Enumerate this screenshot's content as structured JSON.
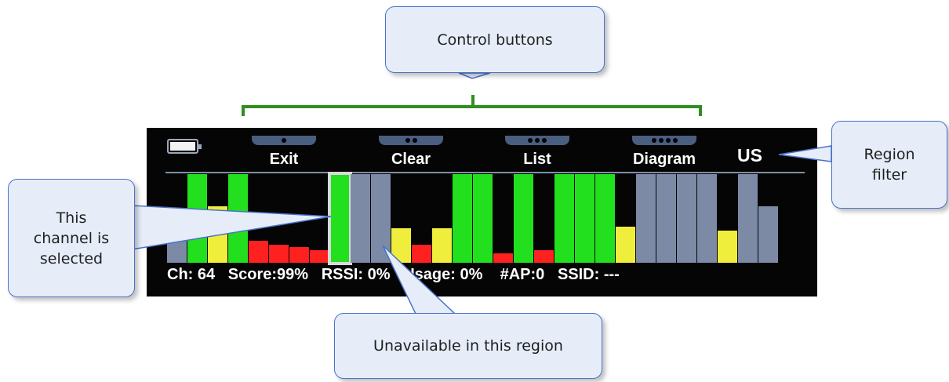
{
  "device": {
    "buttons": [
      {
        "label": "Exit",
        "dots": 1
      },
      {
        "label": "Clear",
        "dots": 2
      },
      {
        "label": "List",
        "dots": 3
      },
      {
        "label": "Diagram",
        "dots": 4
      }
    ],
    "region": "US",
    "status_line": "Ch: 64   Score:99%   RSSI: 0%   Usage: 0%    #AP:0   SSID: ---",
    "channel_bars": [
      {
        "level": 0.25,
        "color": "#7d8aa6"
      },
      {
        "level": 1.0,
        "color": "#22e01e"
      },
      {
        "level": 0.64,
        "color": "#f0ee3c"
      },
      {
        "level": 1.0,
        "color": "#22e01e"
      },
      {
        "level": 0.25,
        "color": "#ff2020"
      },
      {
        "level": 0.2,
        "color": "#ff2020"
      },
      {
        "level": 0.18,
        "color": "#ff2020"
      },
      {
        "level": 0.14,
        "color": "#ff2020"
      },
      {
        "level": 1.0,
        "color": "#22e01e",
        "selected": true
      },
      {
        "level": 1.0,
        "color": "#7d8aa6"
      },
      {
        "level": 1.0,
        "color": "#7d8aa6"
      },
      {
        "level": 0.39,
        "color": "#f0ee3c"
      },
      {
        "level": 0.2,
        "color": "#ff2020"
      },
      {
        "level": 0.39,
        "color": "#f0ee3c"
      },
      {
        "level": 1.0,
        "color": "#22e01e"
      },
      {
        "level": 1.0,
        "color": "#22e01e"
      },
      {
        "level": 0.11,
        "color": "#ff2020"
      },
      {
        "level": 1.0,
        "color": "#22e01e"
      },
      {
        "level": 0.14,
        "color": "#ff2020"
      },
      {
        "level": 1.0,
        "color": "#22e01e"
      },
      {
        "level": 1.0,
        "color": "#22e01e"
      },
      {
        "level": 1.0,
        "color": "#22e01e"
      },
      {
        "level": 0.41,
        "color": "#f0ee3c"
      },
      {
        "level": 1.0,
        "color": "#7d8aa6"
      },
      {
        "level": 1.0,
        "color": "#7d8aa6"
      },
      {
        "level": 1.0,
        "color": "#7d8aa6"
      },
      {
        "level": 1.0,
        "color": "#7d8aa6"
      },
      {
        "level": 0.36,
        "color": "#f0ee3c"
      },
      {
        "level": 1.0,
        "color": "#7d8aa6"
      },
      {
        "level": 0.64,
        "color": "#7d8aa6"
      }
    ]
  },
  "callouts": {
    "control_buttons": "Control buttons",
    "region_filter": "Region\nfilter",
    "channel_selected": "This\nchannel is\nselected",
    "unavailable": "Unavailable in this region"
  },
  "colors": {
    "bracket": "#2f8f1f",
    "callout_bg": "#e6edf9",
    "callout_border": "#4a72c9"
  }
}
